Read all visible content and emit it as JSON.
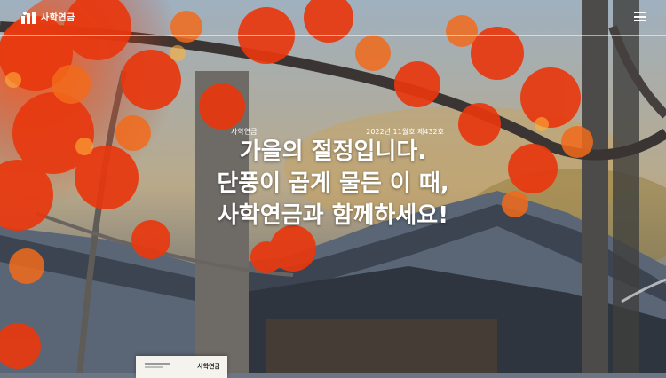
{
  "header": {
    "logo_text": "사학연금",
    "menu_icon": "hamburger-menu-icon"
  },
  "hero": {
    "brand_label": "사학연금",
    "issue_label": "2022년 11월호 제432호",
    "headline_lines": [
      "가을의 절정입니다.",
      "단풍이 곱게 물든 이 때,",
      "사학연금과 함께하세요!"
    ]
  },
  "magazine_card": {
    "title": "사학연금"
  },
  "colors": {
    "text": "#ffffff",
    "leaf_red": "#e8380f",
    "leaf_orange": "#f26a1b"
  }
}
